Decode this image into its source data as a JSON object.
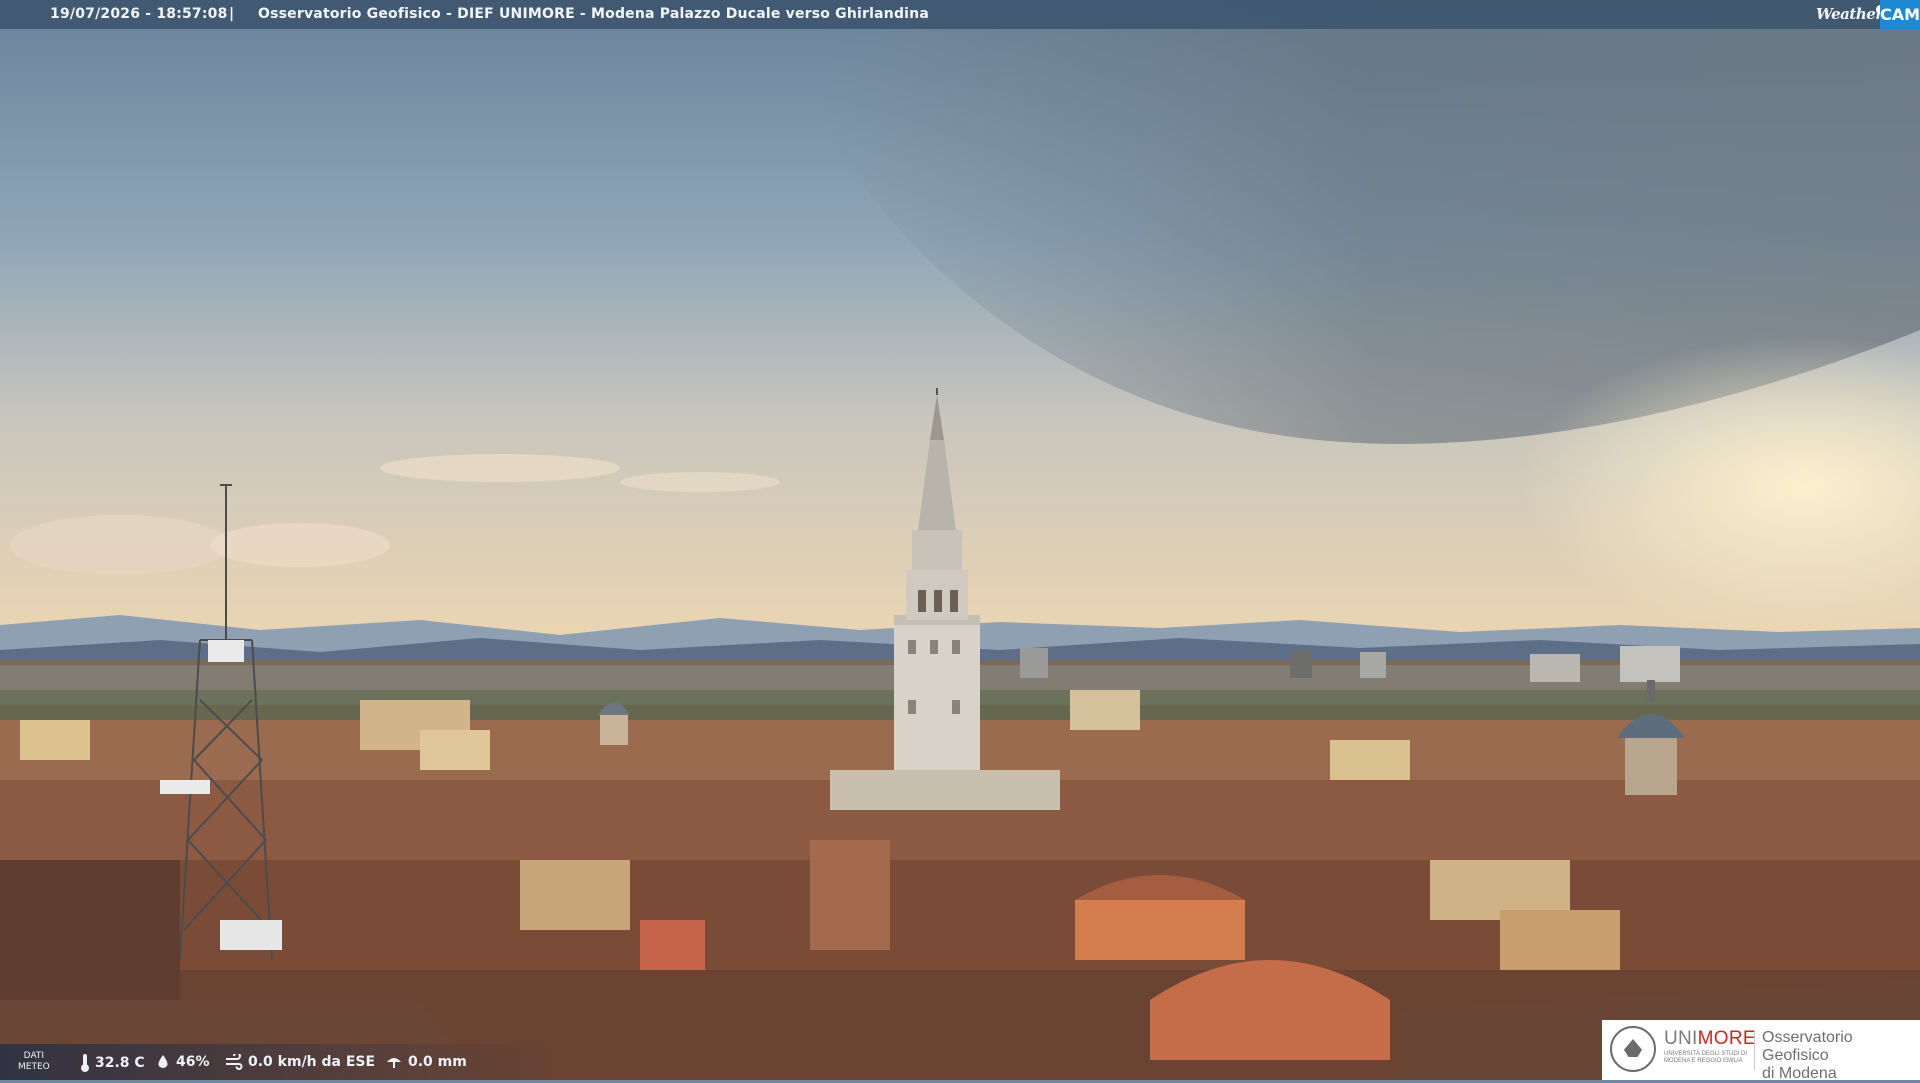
{
  "header": {
    "timestamp": "19/07/2026 - 18:57:08",
    "separator": "|",
    "title": "Osservatorio Geofisico - DIEF UNIMORE - Modena Palazzo Ducale verso Ghirlandina"
  },
  "brand": {
    "prefix": "Weather",
    "suffix": "CAM",
    "accent_color": "#1e88d0"
  },
  "meteo": {
    "label_line1": "DATI",
    "label_line2": "METEO",
    "temperature": "32.8 C",
    "humidity": "46%",
    "wind": "0.0 km/h da ESE",
    "rain": "0.0 mm",
    "icons": [
      "thermometer-icon",
      "humidity-icon",
      "wind-icon",
      "rain-icon"
    ]
  },
  "logo": {
    "uni_part1": "UNI",
    "uni_part2": "MORE",
    "uni_sub": "UNIVERSITÀ DEGLI STUDI DI MODENA E REGGIO EMILIA",
    "observatory_line1": "Osservatorio Geofisico",
    "observatory_line2": "di Modena",
    "accent_color": "#c62b1f"
  },
  "scene": {
    "sky_top": "#6b8399",
    "sky_horizon": "#f1d8b0",
    "roof_color": "#8a5a44"
  }
}
